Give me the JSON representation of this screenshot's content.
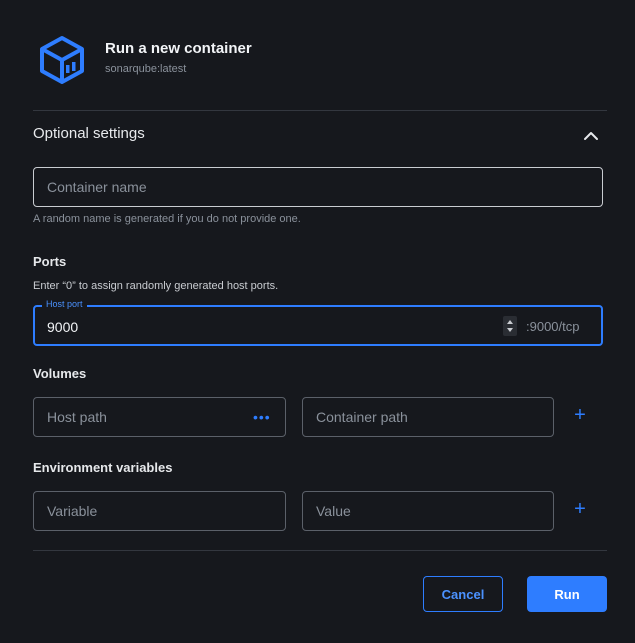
{
  "header": {
    "title": "Run a new container",
    "subtitle": "sonarqube:latest",
    "logo_icon": "cube-icon"
  },
  "optional_settings": {
    "title": "Optional settings",
    "expanded": true,
    "collapse_icon": "chevron-up-icon"
  },
  "container_name": {
    "placeholder": "Container name",
    "value": "",
    "helper": "A random name is generated if you do not provide one."
  },
  "ports": {
    "label": "Ports",
    "helper": "Enter “0” to assign randomly generated host ports.",
    "host_port_label": "Host port",
    "host_port_value": "9000",
    "container_port": ":9000/tcp"
  },
  "volumes": {
    "label": "Volumes",
    "host_path_placeholder": "Host path",
    "browse_icon": "ellipsis-icon",
    "browse_glyph": "•••",
    "container_path_placeholder": "Container path",
    "add_icon": "plus-icon",
    "add_glyph": "+"
  },
  "env": {
    "label": "Environment variables",
    "variable_placeholder": "Variable",
    "value_placeholder": "Value",
    "add_icon": "plus-icon",
    "add_glyph": "+"
  },
  "actions": {
    "cancel_label": "Cancel",
    "run_label": "Run"
  },
  "colors": {
    "background": "#16181d",
    "accent": "#2e7dff",
    "border": "#5b6069",
    "muted_text": "#8a919b"
  }
}
